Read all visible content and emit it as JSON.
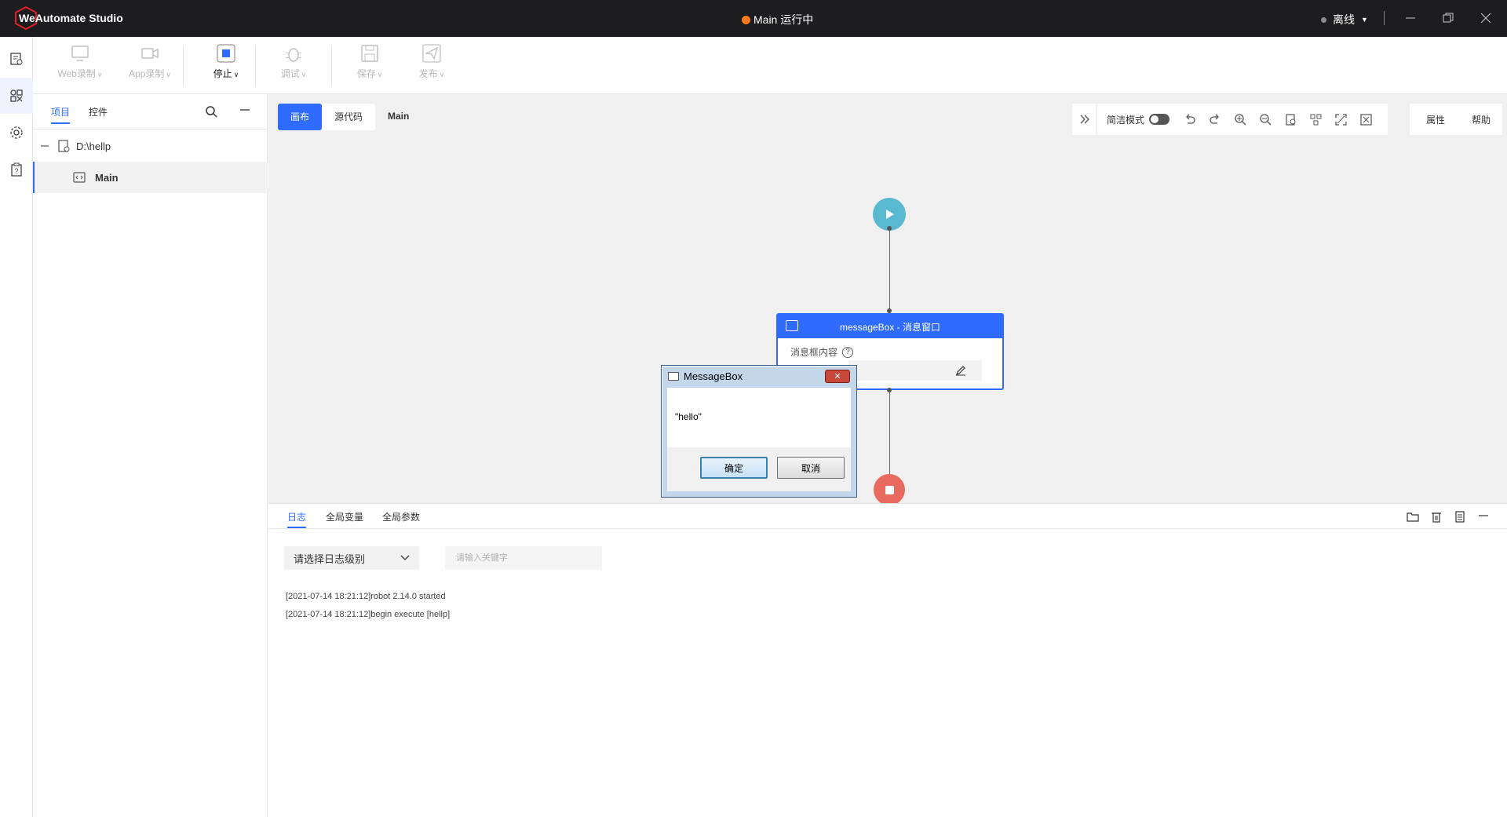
{
  "titlebar": {
    "app_name": "WeAutomate Studio",
    "run_status": "Main 运行中",
    "online_status": "离线"
  },
  "toolbar": {
    "web_record": "Web录制",
    "app_record": "App录制",
    "stop": "停止",
    "debug": "调试",
    "save": "保存",
    "publish": "发布"
  },
  "left_panel": {
    "tab_project": "项目",
    "tab_controls": "控件",
    "tree_root": "D:\\hellp",
    "tree_child": "Main"
  },
  "canvas": {
    "tab_canvas": "画布",
    "tab_source": "源代码",
    "main_tab": "Main",
    "simple_mode": "简洁模式",
    "properties": "属性",
    "help": "帮助",
    "node_title": "messageBox - 消息窗口",
    "node_field_label": "消息框内容"
  },
  "messagebox": {
    "title": "MessageBox",
    "message": "\"hello\"",
    "ok": "确定",
    "cancel": "取消"
  },
  "log_panel": {
    "tab_log": "日志",
    "tab_global_vars": "全局变量",
    "tab_global_params": "全局参数",
    "level_select": "请选择日志级别",
    "keyword_placeholder": "请输入关键字",
    "lines": [
      "[2021-07-14 18:21:12]robot 2.14.0 started",
      "[2021-07-14 18:21:12]begin execute [hellp]"
    ]
  },
  "colors": {
    "accent": "#2f6bff",
    "start_node": "#59b9d0",
    "end_node": "#e86a5e",
    "run_dot": "#ff7a1a"
  }
}
